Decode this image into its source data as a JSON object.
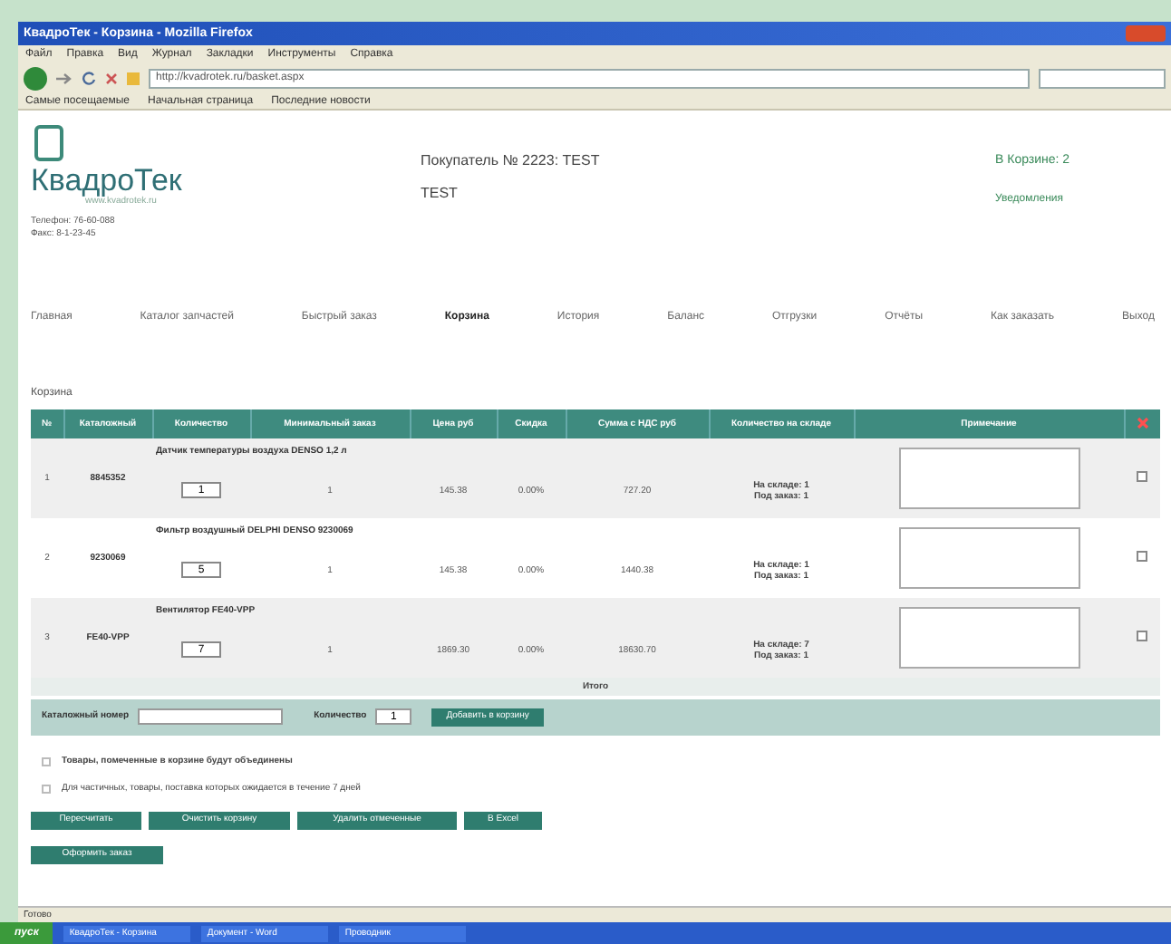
{
  "window": {
    "title": "КвадроТек - Корзина - Mozilla Firefox"
  },
  "menu": [
    "Файл",
    "Правка",
    "Вид",
    "Журнал",
    "Закладки",
    "Инструменты",
    "Справка"
  ],
  "address": "http://kvadrotek.ru/basket.aspx",
  "bookmarks": [
    "Самые посещаемые",
    "Начальная страница",
    "Последние новости"
  ],
  "header": {
    "logo": "КвадроТек",
    "logo_sub": "www.kvadrotek.ru",
    "customer": "Покупатель № 2223: TEST",
    "name": "TEST",
    "cart_link": "В Корзине: 2",
    "notice_link": "Уведомления",
    "contacts": [
      "Телефон: 76-60-088",
      "Факс: 8-1-23-45"
    ]
  },
  "nav": [
    {
      "label": "Главная",
      "selected": false
    },
    {
      "label": "Каталог запчастей",
      "selected": false
    },
    {
      "label": "Быстрый заказ",
      "selected": false
    },
    {
      "label": "Корзина",
      "selected": true
    },
    {
      "label": "История",
      "selected": false
    },
    {
      "label": "Баланс",
      "selected": false
    },
    {
      "label": "Отгрузки",
      "selected": false
    },
    {
      "label": "Отчёты",
      "selected": false
    },
    {
      "label": "Как заказать",
      "selected": false
    },
    {
      "label": "Выход",
      "selected": false
    }
  ],
  "section_title": "Корзина",
  "table": {
    "columns": [
      "№",
      "Каталожный",
      "Количество",
      "Минимальный заказ",
      "Цена руб",
      "Скидка",
      "Сумма с НДС руб",
      "Количество на складе",
      "Примечание"
    ],
    "rows": [
      {
        "index": "1",
        "code": "8845352",
        "name": "Датчик температуры воздуха DENSO 1,2 л",
        "qty": "1",
        "min_qty": "1",
        "price": "145.38",
        "discount": "0.00%",
        "sum": "727.20",
        "stock": [
          "На складе: 1",
          "Под заказ: 1"
        ],
        "checked": false
      },
      {
        "index": "2",
        "code": "9230069",
        "name": "Фильтр воздушный DELPHI DENSO 9230069",
        "qty": "5",
        "min_qty": "1",
        "price": "145.38",
        "discount": "0.00%",
        "sum": "1440.38",
        "stock": [
          "На складе: 1",
          "Под заказ: 1"
        ],
        "checked": false
      },
      {
        "index": "3",
        "code": "FE40-VPP",
        "name": "Вентилятор FE40-VPP",
        "qty": "7",
        "min_qty": "1",
        "price": "1869.30",
        "discount": "0.00%",
        "sum": "18630.70",
        "stock": [
          "На складе: 7",
          "Под заказ: 1"
        ],
        "checked": false
      }
    ],
    "total_label": "Итого"
  },
  "add_bar": {
    "code_label": "Каталожный номер",
    "qty_label": "Количество",
    "qty_value": "1",
    "button": "Добавить в корзину"
  },
  "options": [
    {
      "label": "Товары, помеченные в корзине будут объединены",
      "checked": false
    },
    {
      "label": "Для частичных, товары, поставка которых ожидается в течение 7 дней",
      "checked": false
    }
  ],
  "buttons": [
    "Пересчитать",
    "Очистить корзину",
    "Удалить отмеченные",
    "В Excel"
  ],
  "submit": "Оформить заказ",
  "status": "Готово",
  "taskbar": {
    "start": "пуск",
    "items": [
      "КвадроТек - Корзина",
      "Документ - Word",
      "Проводник"
    ]
  }
}
